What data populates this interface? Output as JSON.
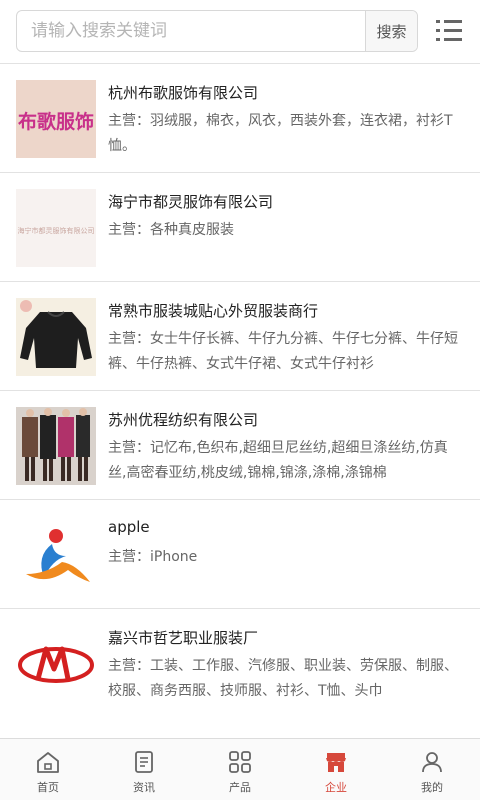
{
  "search": {
    "placeholder": "请输入搜索关键词",
    "button_label": "搜索"
  },
  "companies": [
    {
      "name": "杭州布歌服饰有限公司",
      "business": "主营：羽绒服，棉衣，风衣，西装外套，连衣裙，衬衫T恤。",
      "logo_text": "布歌服饰"
    },
    {
      "name": "海宁市都灵服饰有限公司",
      "business": "主营：各种真皮服装",
      "logo_text": "海宁市都灵服饰有限公司"
    },
    {
      "name": "常熟市服装城贴心外贸服装商行",
      "business": "主营：女士牛仔长裤、牛仔九分裤、牛仔七分裤、牛仔短裤、牛仔热裤、女式牛仔裙、女式牛仔衬衫"
    },
    {
      "name": "苏州优程纺织有限公司",
      "business": "主营：记忆布,色织布,超细旦尼丝纺,超细旦涤丝纺,仿真丝,高密春亚纺,桃皮绒,锦棉,锦涤,涤棉,涤锦棉"
    },
    {
      "name": "apple",
      "business": "主营：iPhone"
    },
    {
      "name": "嘉兴市哲艺职业服装厂",
      "business": "主营：工装、工作服、汽修服、职业装、劳保服、制服、校服、商务西服、技师服、衬衫、T恤、头巾"
    }
  ],
  "tabbar": {
    "home": "首页",
    "news": "资讯",
    "products": "产品",
    "companies": "企业",
    "mine": "我的"
  },
  "colors": {
    "accent": "#d6483b",
    "divider": "#e2e2e2"
  }
}
